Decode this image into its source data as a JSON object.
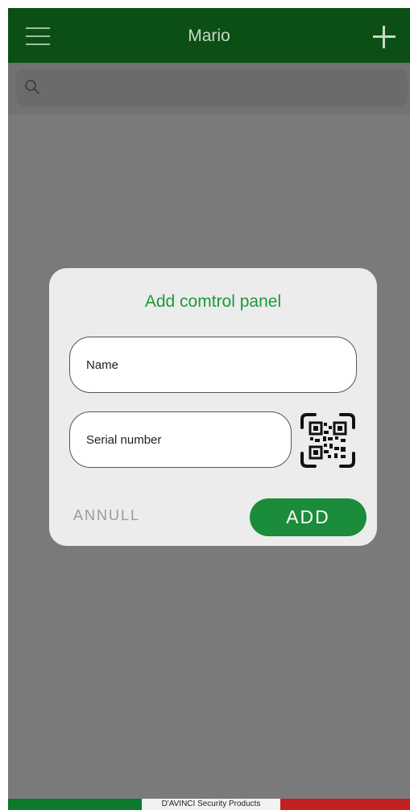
{
  "header": {
    "title": "Mario",
    "menu_icon": "hamburger-menu-icon",
    "add_icon": "plus-icon",
    "background": "#0b4f14"
  },
  "search": {
    "placeholder": "",
    "icon": "search-icon"
  },
  "dialog": {
    "title": "Add comtrol panel",
    "name_placeholder": "Name",
    "serial_placeholder": "Serial number",
    "qr_icon": "qr-code-scan-icon",
    "cancel_label": "ANNULL",
    "add_label": "ADD",
    "accent_color": "#1a8c3a"
  },
  "footer": {
    "text": "D'AVINCI Security Products",
    "colors": [
      "#0b7a2a",
      "#f2f2f2",
      "#c0201e"
    ]
  }
}
